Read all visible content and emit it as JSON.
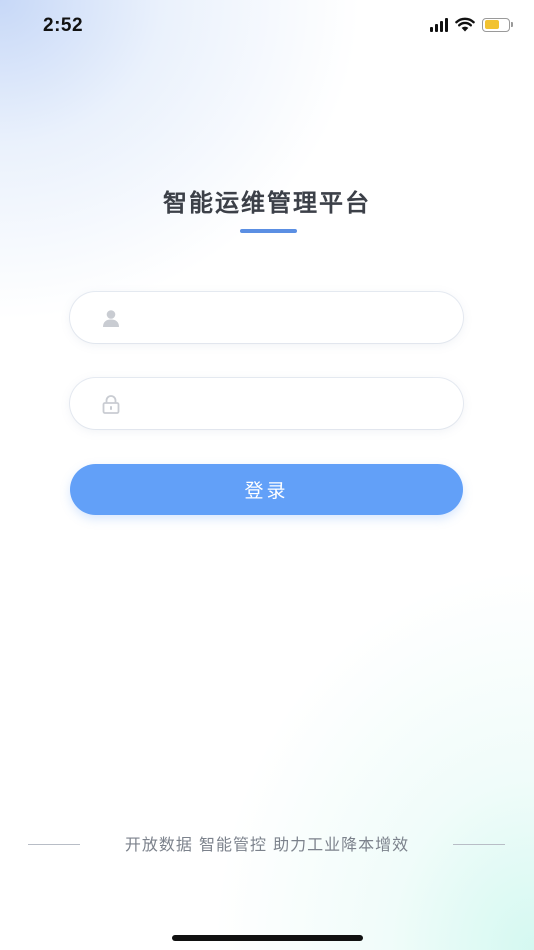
{
  "status_bar": {
    "time": "2:52",
    "battery_color": "#f2c230"
  },
  "login": {
    "title": "智能运维管理平台",
    "username": {
      "placeholder": "",
      "value": "",
      "icon": "user-icon"
    },
    "password": {
      "placeholder": "",
      "value": "",
      "icon": "lock-icon"
    },
    "submit_label": "登录",
    "accent_color": "#62a0f8",
    "title_underline_color": "#5b8fe3"
  },
  "footer": {
    "slogan": "开放数据 智能管控 助力工业降本增效"
  }
}
